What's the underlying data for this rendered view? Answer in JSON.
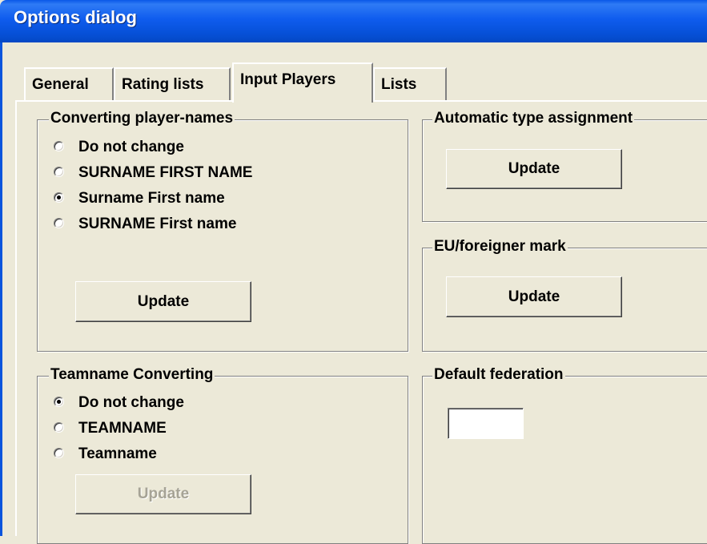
{
  "window": {
    "title": "Options dialog"
  },
  "tabs": [
    {
      "label": "General"
    },
    {
      "label": "Rating lists"
    },
    {
      "label": "Input Players",
      "active": true
    },
    {
      "label": "Lists"
    }
  ],
  "converting_names": {
    "legend": "Converting player-names",
    "options": [
      "Do not change",
      "SURNAME FIRST NAME",
      "Surname First name",
      "SURNAME First name"
    ],
    "selected": "Surname First name",
    "update_label": "Update"
  },
  "teamname_converting": {
    "legend": "Teamname Converting",
    "options": [
      "Do not change",
      "TEAMNAME",
      "Teamname"
    ],
    "selected": "Do not change",
    "update_label": "Update",
    "update_enabled": false
  },
  "auto_type": {
    "legend": "Automatic type assignment",
    "update_label": "Update"
  },
  "eu_mark": {
    "legend": "EU/foreigner mark",
    "update_label": "Update"
  },
  "default_federation": {
    "legend": "Default federation",
    "value": ""
  }
}
